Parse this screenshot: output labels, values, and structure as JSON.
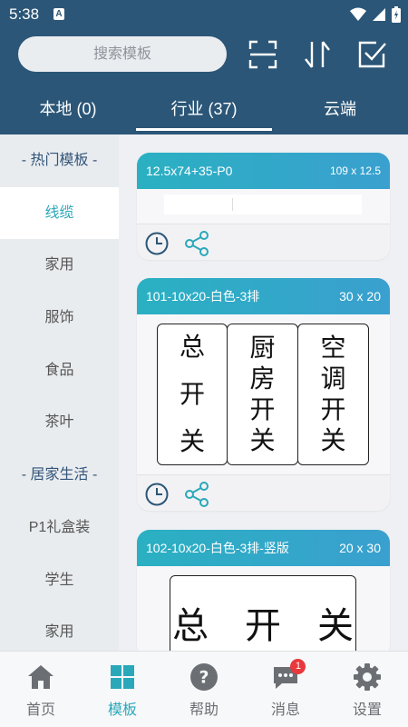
{
  "status_bar": {
    "time": "5:38",
    "notification_letter": "A"
  },
  "search": {
    "placeholder": "搜索模板"
  },
  "tabs": [
    {
      "label": "本地 (0)"
    },
    {
      "label": "行业 (37)"
    },
    {
      "label": "云端"
    }
  ],
  "sidebar": {
    "items": [
      {
        "label": "- 热门模板 -"
      },
      {
        "label": "线缆"
      },
      {
        "label": "家用"
      },
      {
        "label": "服饰"
      },
      {
        "label": "食品"
      },
      {
        "label": "茶叶"
      },
      {
        "label": "- 居家生活 -"
      },
      {
        "label": "P1礼盒装"
      },
      {
        "label": "学生"
      },
      {
        "label": "家用"
      }
    ]
  },
  "templates": [
    {
      "title": "12.5x74+35-P0",
      "size": "109 x 12.5"
    },
    {
      "title": "101-10x20-白色-3排",
      "size": "30 x 20",
      "labels": [
        {
          "chars": [
            "总",
            "开",
            "关"
          ]
        },
        {
          "chars": [
            "厨",
            "房",
            "开",
            "关"
          ]
        },
        {
          "chars": [
            "空",
            "调",
            "开",
            "关"
          ]
        }
      ]
    },
    {
      "title": "102-10x20-白色-3排-竖版",
      "size": "20 x 30",
      "preview_text": "总　开　关"
    }
  ],
  "bottom_nav": [
    {
      "label": "首页",
      "icon": "home-icon"
    },
    {
      "label": "模板",
      "icon": "template-grid-icon"
    },
    {
      "label": "帮助",
      "icon": "help-icon"
    },
    {
      "label": "消息",
      "icon": "message-icon",
      "badge": "1"
    },
    {
      "label": "设置",
      "icon": "settings-icon"
    }
  ],
  "colors": {
    "header": "#2b5677",
    "accent": "#2aa8ba",
    "badge": "#e8383d"
  }
}
